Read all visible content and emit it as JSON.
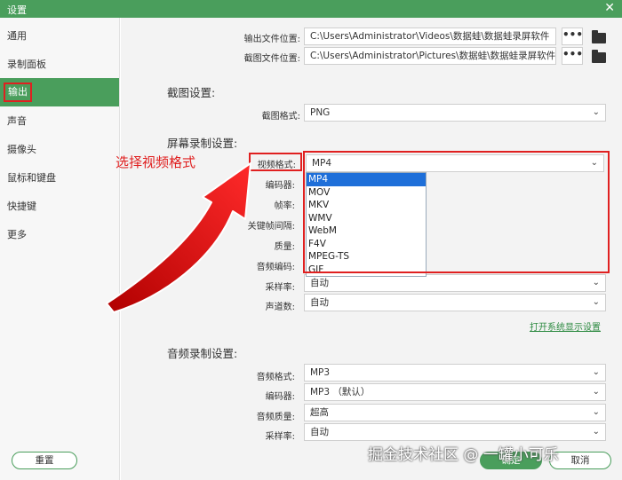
{
  "window": {
    "title": "设置",
    "close_glyph": "✕"
  },
  "sidebar": {
    "items": [
      {
        "label": "通用"
      },
      {
        "label": "录制面板"
      },
      {
        "label": "输出"
      },
      {
        "label": "声音"
      },
      {
        "label": "摄像头"
      },
      {
        "label": "鼠标和键盘"
      },
      {
        "label": "快捷键"
      },
      {
        "label": "更多"
      }
    ]
  },
  "output": {
    "output_location_label": "输出文件位置:",
    "output_location_value": "C:\\Users\\Administrator\\Videos\\数据蛙\\数据蛙录屏软件",
    "screenshot_location_label": "截图文件位置:",
    "screenshot_location_value": "C:\\Users\\Administrator\\Pictures\\数据蛙\\数据蛙录屏软件",
    "browse_glyph": "•••"
  },
  "screenshot_settings": {
    "section_title": "截图设置:",
    "format_label": "截图格式:",
    "format_value": "PNG"
  },
  "screen_settings": {
    "section_title": "屏幕录制设置:",
    "video_format_label": "视频格式:",
    "video_format_value": "MP4",
    "encoder_label": "编码器:",
    "fps_label": "帧率:",
    "keyframe_label": "关键帧间隔:",
    "quality_label": "质量:",
    "audio_encoder_label": "音频编码:",
    "sample_rate_label": "采样率:",
    "sample_rate_value": "自动",
    "channels_label": "声道数:",
    "channels_value": "自动",
    "display_link": "打开系统显示设置",
    "format_options": [
      "MP4",
      "MOV",
      "MKV",
      "WMV",
      "WebM",
      "F4V",
      "MPEG-TS",
      "GIF"
    ]
  },
  "audio_settings": {
    "section_title": "音频录制设置:",
    "format_label": "音频格式:",
    "format_value": "MP3",
    "encoder_label": "编码器:",
    "encoder_value": "MP3 （默认）",
    "quality_label": "音频质量:",
    "quality_value": "超高",
    "sample_rate_label": "采样率:",
    "sample_rate_value": "自动"
  },
  "footer": {
    "reset_label": "重置",
    "ok_label": "确定",
    "cancel_label": "取消"
  },
  "annotation": {
    "text": "选择视频格式"
  },
  "watermark": {
    "text": "掘金技术社区 @ 一罐小可乐"
  },
  "colors": {
    "accent": "#4a9e5c",
    "highlight": "#e02020",
    "selection": "#1e6fd9"
  },
  "icons": {
    "folder": "folder-icon",
    "chevron": "chevron-down-icon",
    "arrow": "red-arrow"
  }
}
